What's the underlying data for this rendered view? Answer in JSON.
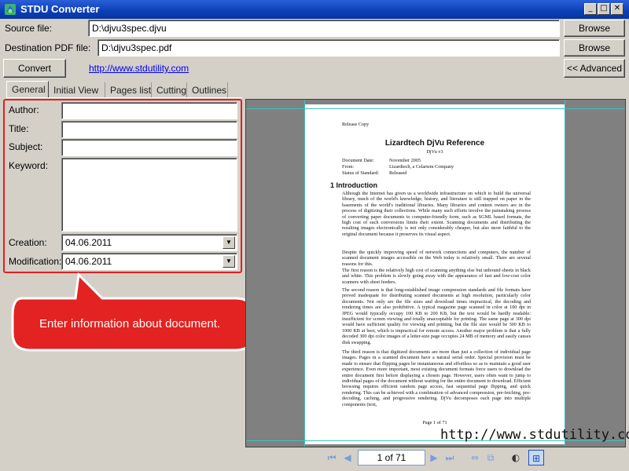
{
  "window": {
    "title": "STDU Converter"
  },
  "source": {
    "label": "Source file:",
    "value": "D:\\djvu3spec.djvu",
    "browse": "Browse"
  },
  "destination": {
    "label": "Destination PDF file:",
    "value": "D:\\djvu3spec.pdf",
    "browse": "Browse"
  },
  "actions": {
    "convert": "Convert",
    "link": "http://www.stdutility.com",
    "advanced": "<< Advanced"
  },
  "tabs": [
    "General",
    "Initial View",
    "Pages list",
    "Cutting",
    "Outlines"
  ],
  "general": {
    "author_label": "Author:",
    "author_value": "",
    "title_label": "Title:",
    "title_value": "",
    "subject_label": "Subject:",
    "subject_value": "",
    "keyword_label": "Keyword:",
    "keyword_value": "",
    "creation_label": "Creation:",
    "creation_value": "04.06.2011",
    "modification_label": "Modification:",
    "modification_value": "04.06.2011"
  },
  "callout": {
    "text": "Enter information about document."
  },
  "preview": {
    "release": "Release Copy",
    "doc_title": "Lizardtech DjVu Reference",
    "doc_subtitle": "DjVu v3",
    "meta": [
      {
        "k": "Document Date:",
        "v": "November 2005"
      },
      {
        "k": "From:",
        "v": "Lizardtech, a Celartem Company"
      },
      {
        "k": "Status of Standard:",
        "v": "Released"
      }
    ],
    "section": "1   Introduction",
    "paragraphs": [
      "Although the Internet has given us a worldwide infrastructure on which to build the universal library, much of the world's knowledge, history, and literature is still trapped on paper in the basements of the world's traditional libraries. Many libraries and content owners are in the process of digitizing their collections. While many such efforts involve the painstaking process of converting paper documents to computer-friendly form, such as SGML based formats, the high cost of such conversions limits their extent. Scanning documents and distributing the resulting images electronically is not only considerably cheaper, but also more faithful to the original document because it preserves its visual aspect.",
      "Despite the quickly improving speed of network connections and computers, the number of scanned document images accessible on the Web today is relatively small. There are several reasons for this.",
      "The first reason is the relatively high cost of scanning anything else but unbound sheets in black and white. This problem is slowly going away with the appearance of fast and low-cost color scanners with sheet feeders.",
      "The second reason is that long-established image compression standards and file formats have proved inadequate for distributing scanned documents at high resolution, particularly color documents. Not only are the file sizes and download times impractical, the decoding and rendering times are also prohibitive. A typical magazine page scanned in color at 100 dpi in JPEG would typically occupy 100 KB to 200 KB, but the text would be hardly readable: insufficient for screen viewing and totally unacceptable for printing. The same page at 300 dpi would have sufficient quality for viewing and printing, but the file size would be 300 KB to 1000 KB at best, which is impractical for remote access. Another major problem is that a fully decoded 300 dpi color images of a letter-size page occupies 24 MB of memory and easily causes disk swapping.",
      "The third reason is that digitized documents are more than just a collection of individual page images. Pages in a scanned document have a natural serial order. Special provision must be made to ensure that flipping pages be instantaneous and effortless so as to maintain a good user experience. Even more important, most existing document formats force users to download the entire document first before displaying a chosen page. However, users often want to jump to individual pages of the document without waiting for the entire document to download. Efficient browsing requires efficient random page access, fast sequential page flipping, and quick rendering. This can be achieved with a combination of advanced compression, pre-fetching, pre-decoding, caching, and progressive rendering. DjVu decomposes each page into multiple components (text,"
    ],
    "page_footer": "Page 1 of 71",
    "watermark": "http://www.stdutility.com"
  },
  "navigation": {
    "page_indicator": "1 of 71"
  }
}
